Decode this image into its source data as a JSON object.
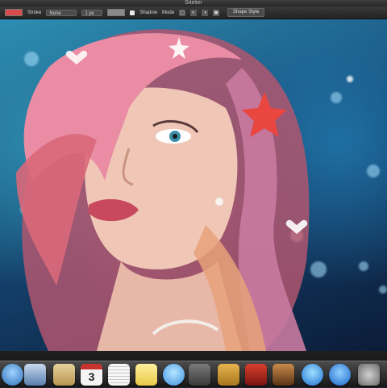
{
  "window": {
    "title": "Sitelier"
  },
  "toolbar": {
    "stroke_label": "Stroke",
    "stroke_value": "None",
    "size_value": "1 px",
    "shadow_label": "Shadow",
    "mode_label": "Mode",
    "shape_style_label": "Shape Style",
    "fill_color": "#d84c4c",
    "stroke_color": "#8a8a8a"
  },
  "canvas": {
    "image": "portrait-woman-pink-hair-bokeh",
    "sticker": "red-star",
    "sticker_color": "#e8463f"
  },
  "dock": {
    "items": [
      "finder-icon",
      "preview-icon",
      "notes-icon",
      "calendar-icon",
      "textedit-icon",
      "stickies-icon",
      "messages-icon",
      "facetime-icon",
      "iphoto-icon",
      "photo-booth-icon",
      "slideshow-icon",
      "itunes-icon",
      "app-store-icon",
      "system-preferences-icon"
    ],
    "calendar_day": "3"
  }
}
